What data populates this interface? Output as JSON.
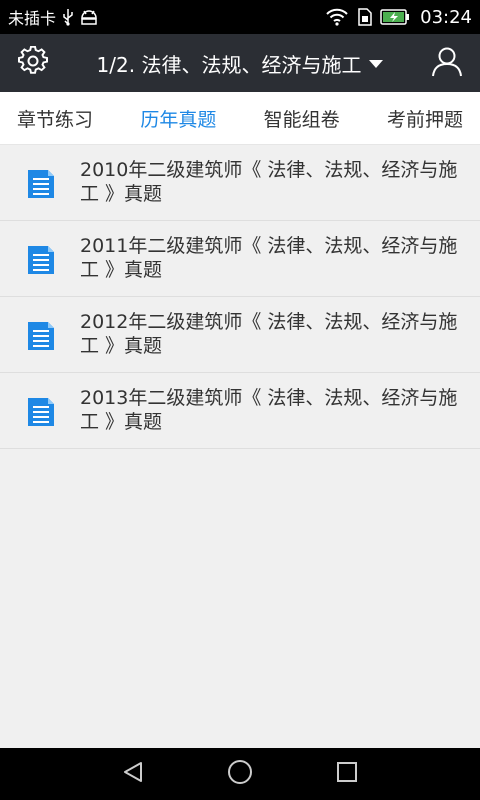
{
  "status_bar": {
    "carrier": "未插卡",
    "time": "03:24",
    "icons": [
      "usb-icon",
      "android-debug-icon",
      "wifi-icon",
      "sim-icon",
      "battery-charging-icon"
    ]
  },
  "app_bar": {
    "title": "1/2. 法律、法规、经济与施工",
    "left_icon": "gear-icon",
    "right_icon": "user-icon",
    "dropdown_icon": "caret-down-icon"
  },
  "tabs": [
    {
      "label": "章节练习",
      "active": false
    },
    {
      "label": "历年真题",
      "active": true
    },
    {
      "label": "智能组卷",
      "active": false
    },
    {
      "label": "考前押题",
      "active": false
    }
  ],
  "list_items": [
    {
      "title": "2010年二级建筑师《 法律、法规、经济与施工 》真题",
      "icon": "document-icon"
    },
    {
      "title": "2011年二级建筑师《 法律、法规、经济与施工 》真题",
      "icon": "document-icon"
    },
    {
      "title": "2012年二级建筑师《 法律、法规、经济与施工 》真题",
      "icon": "document-icon"
    },
    {
      "title": "2013年二级建筑师《 法律、法规、经济与施工 》真题",
      "icon": "document-icon"
    }
  ],
  "nav_bar": {
    "icons": [
      "back-icon",
      "home-icon",
      "recents-icon"
    ]
  },
  "colors": {
    "accent": "#1e88e5",
    "app_bar": "#2b2e34",
    "background": "#f0f0f0"
  }
}
